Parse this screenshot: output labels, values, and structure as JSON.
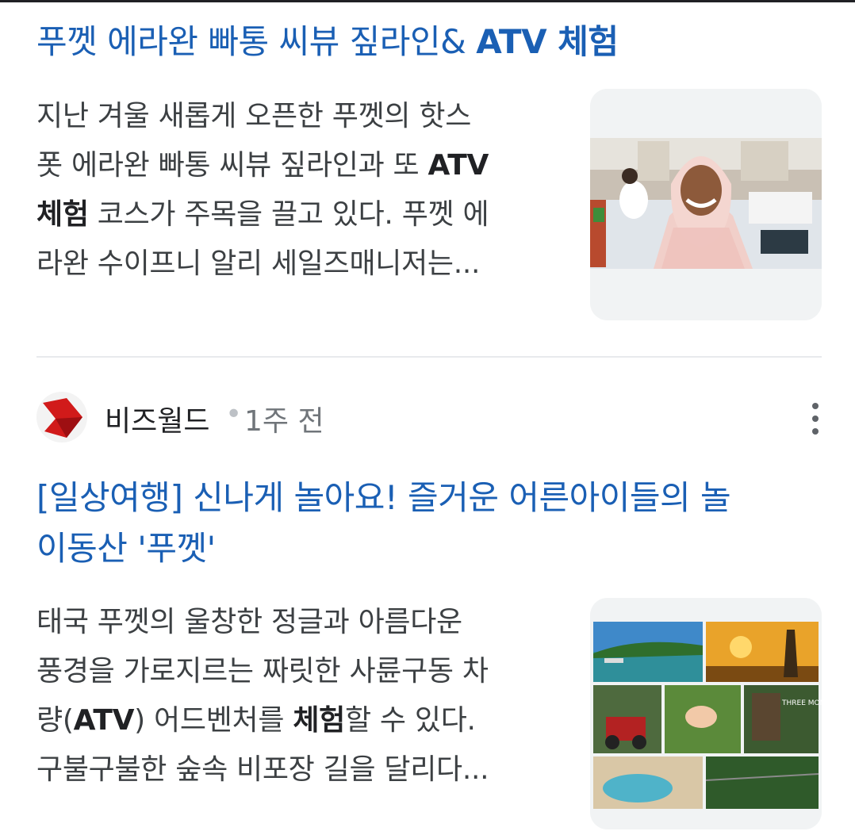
{
  "article1": {
    "title_prefix": "푸껫 에라완 빠통 씨뷰 짚라인& ",
    "title_bold": "ATV 체험",
    "snippet_parts": [
      "지난 겨울 새롭게 오픈한 푸껫의 핫스",
      "폿 에라완 빠통 씨뷰 짚라인과 또 ",
      "ATV",
      "체험",
      " 코스가 주목을 끌고 있다. 푸껫 에",
      "라완 수이프니 알리 세일즈매니저는..."
    ],
    "thumbnail_label": "woman-in-hijab-photo"
  },
  "article2": {
    "source_name": "비즈월드",
    "separator": "•",
    "time_ago": "1주 전",
    "title_line1": "[일상여행] 신나게 놀아요! 즐거운 어른아이들의 놀",
    "title_line2": "이동산 '푸껫'",
    "snippet_parts": [
      "태국 푸껫의 울창한 정글과 아름다운",
      "풍경을 가로지르는 짜릿한 사륜구동 차",
      "량(",
      "ATV",
      ") 어드벤처를 ",
      "체험",
      "할 수 있다.",
      "구불구불한 숲속 비포장 길을 달리다..."
    ],
    "thumbnail_label": "phuket-collage-photo",
    "collage_sign": "THREE MONKEYS"
  },
  "colors": {
    "link": "#1a5fb4",
    "text": "#3c4043",
    "muted": "#70757a",
    "logo_red": "#d11a1a"
  },
  "icons": {
    "more": "more-vert-icon",
    "source_logo": "bizworld-logo"
  }
}
